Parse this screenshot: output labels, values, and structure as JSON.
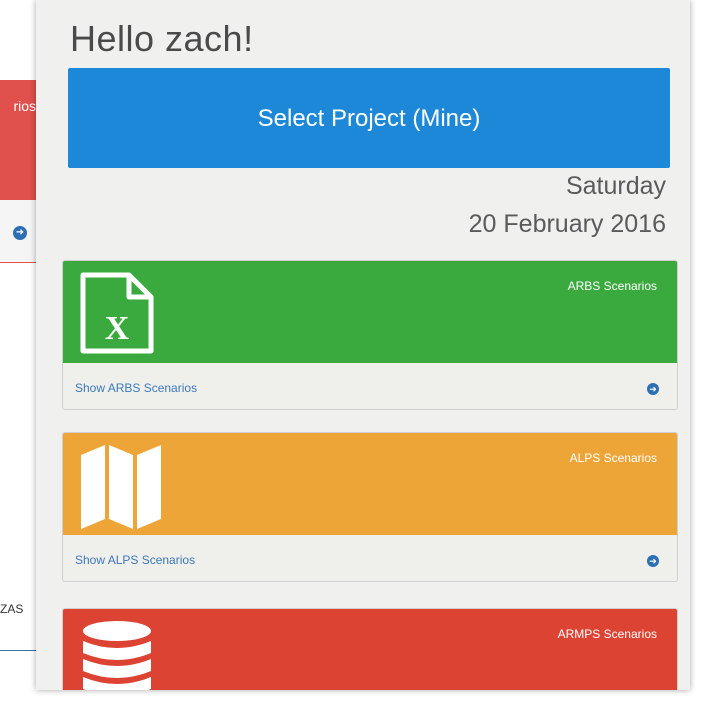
{
  "background": {
    "red_panel_label": "rios",
    "footer_text": "ZAS"
  },
  "greeting": "Hello zach!",
  "select_project": "Select Project (Mine)",
  "date": {
    "weekday": "Saturday",
    "full": "20 February 2016"
  },
  "cards": [
    {
      "title": "ARBS Scenarios",
      "link": "Show ARBS Scenarios",
      "color": "#3aaa3f",
      "icon": "excel-file-icon"
    },
    {
      "title": "ALPS Scenarios",
      "link": "Show ALPS Scenarios",
      "color": "#eea537",
      "icon": "map-icon"
    },
    {
      "title": "ARMPS Scenarios",
      "link": "",
      "color": "#dc4333",
      "icon": "database-icon"
    }
  ],
  "colors": {
    "primary": "#1e88d8",
    "link": "#3d79b8"
  }
}
